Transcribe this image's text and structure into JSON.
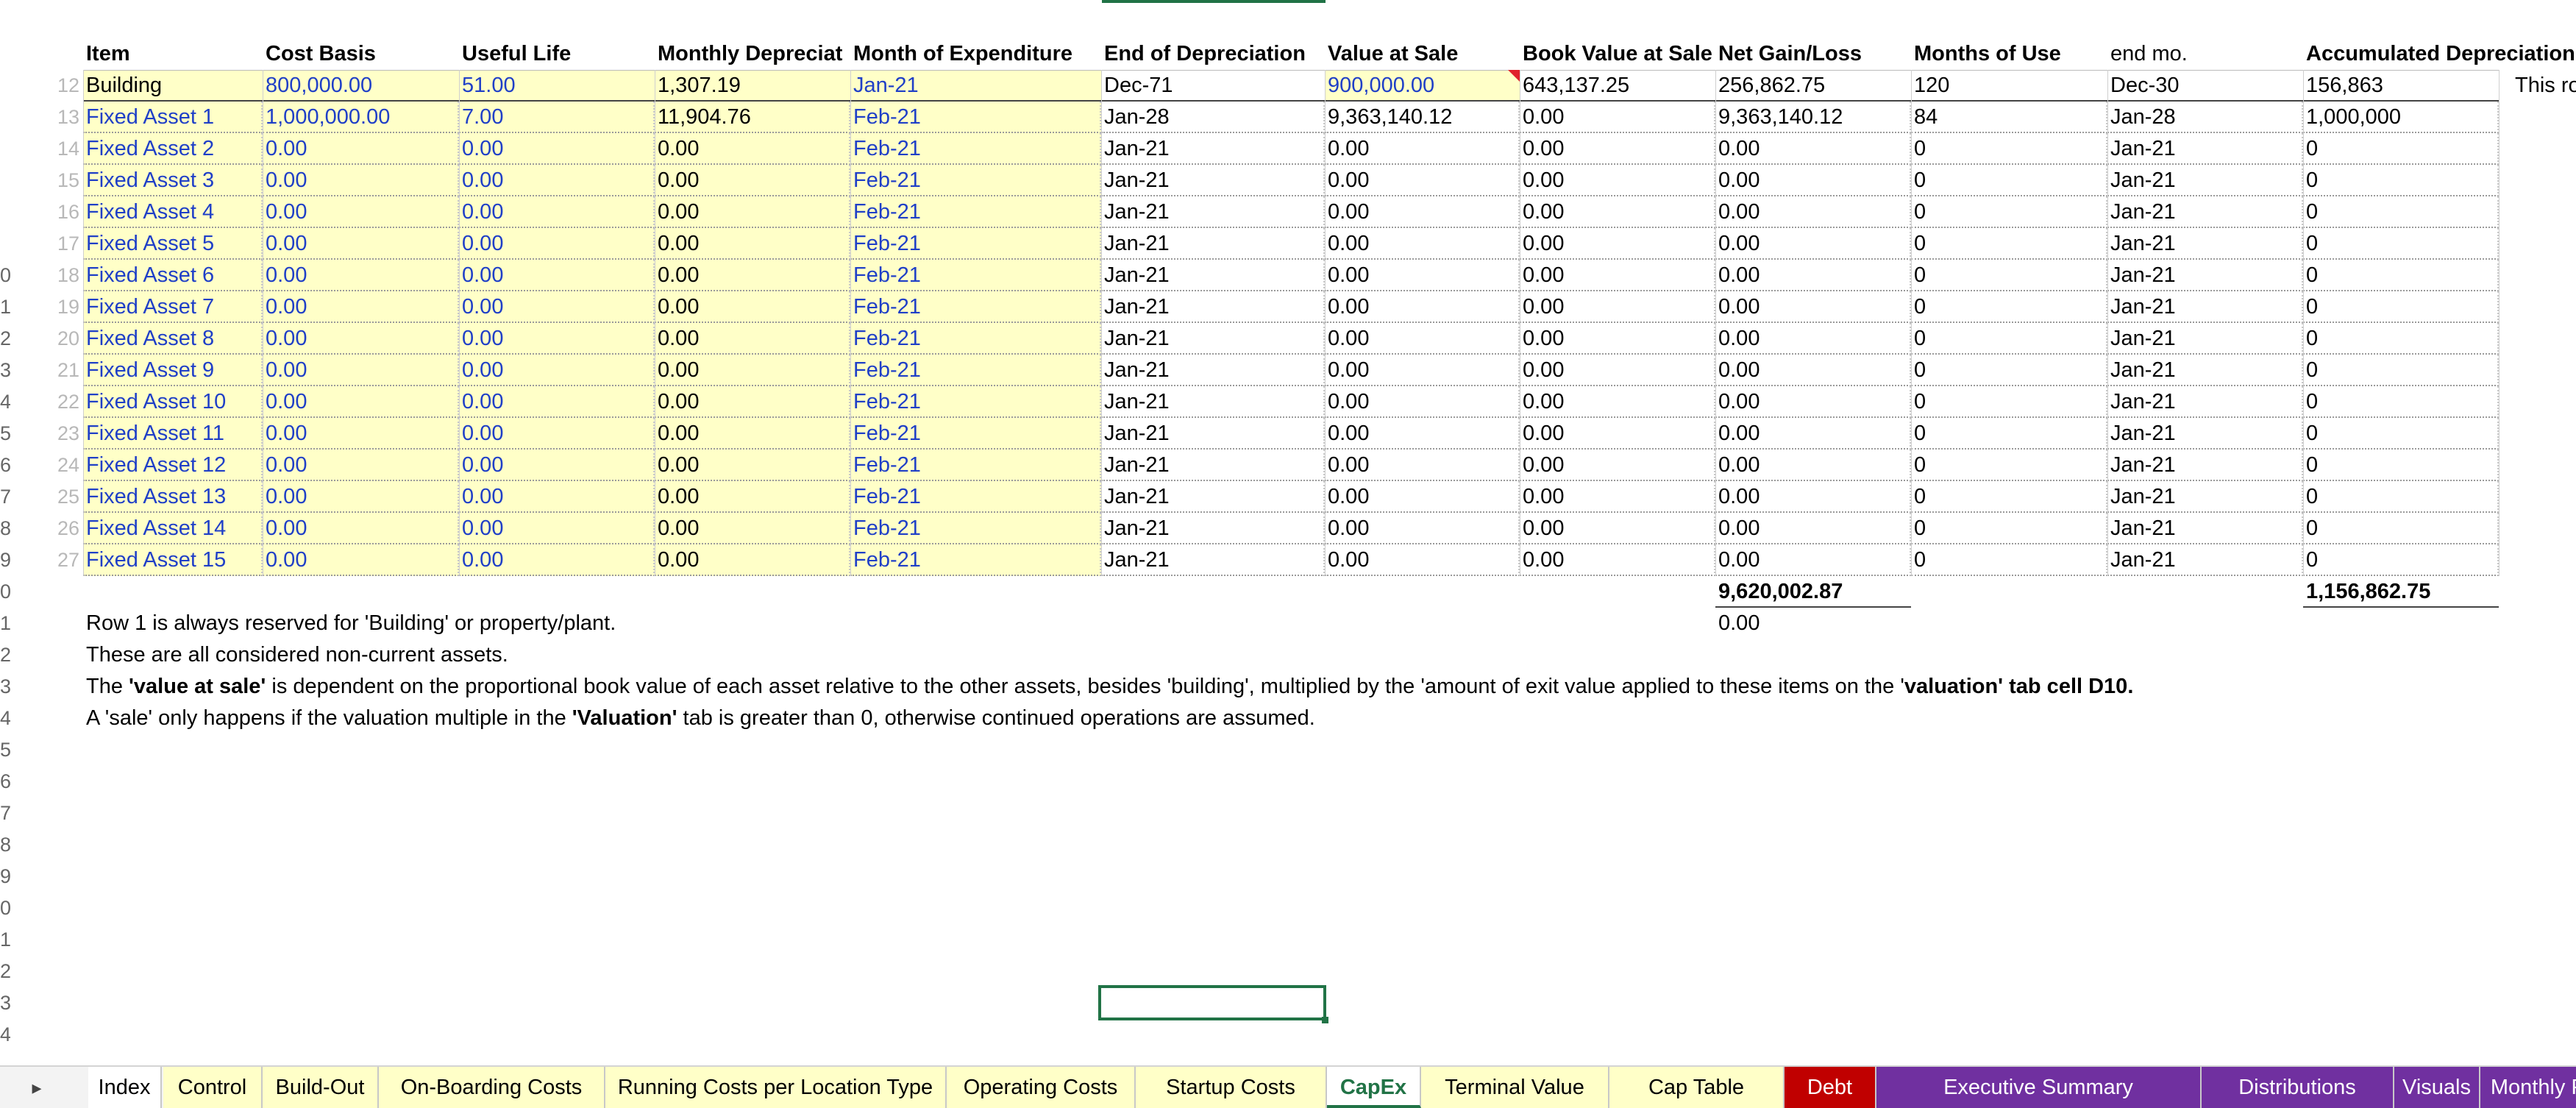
{
  "sheet": {
    "headers": [
      "Item",
      "Cost Basis",
      "Useful Life",
      "Monthly Depreciat",
      "Month of Expenditure",
      "End of Depreciation",
      "Value at Sale",
      "Book Value at Sale",
      "Net Gain/Loss",
      "Months of Use",
      "end mo.",
      "Accumulated Depreciation"
    ],
    "header_bold": [
      true,
      true,
      true,
      true,
      true,
      true,
      true,
      true,
      true,
      true,
      false,
      true
    ],
    "row_numbers": [
      "12",
      "13",
      "14",
      "15",
      "16",
      "17",
      "18",
      "19",
      "20",
      "21",
      "22",
      "23",
      "24",
      "25",
      "26",
      "27"
    ],
    "left_edge_numbers": [
      "",
      "",
      "",
      "",
      "",
      "",
      "",
      "0",
      "1",
      "2",
      "3",
      "4",
      "5",
      "6",
      "7",
      "8",
      "9",
      "0",
      "1",
      "2",
      "3",
      "4",
      "5",
      "6",
      "7",
      "8",
      "9",
      "0",
      "1",
      "2",
      "3",
      "4"
    ],
    "rows": [
      [
        "Building",
        "800,000.00",
        "51.00",
        "1,307.19",
        "Jan-21",
        "Dec-71",
        "900,000.00",
        "643,137.25",
        "256,862.75",
        "120",
        "Dec-30",
        "156,863"
      ],
      [
        "Fixed Asset 1",
        "1,000,000.00",
        "7.00",
        "11,904.76",
        "Feb-21",
        "Jan-28",
        "9,363,140.12",
        "0.00",
        "9,363,140.12",
        "84",
        "Jan-28",
        "1,000,000"
      ],
      [
        "Fixed Asset 2",
        "0.00",
        "0.00",
        "0.00",
        "Feb-21",
        "Jan-21",
        "0.00",
        "0.00",
        "0.00",
        "0",
        "Jan-21",
        "0"
      ],
      [
        "Fixed Asset 3",
        "0.00",
        "0.00",
        "0.00",
        "Feb-21",
        "Jan-21",
        "0.00",
        "0.00",
        "0.00",
        "0",
        "Jan-21",
        "0"
      ],
      [
        "Fixed Asset 4",
        "0.00",
        "0.00",
        "0.00",
        "Feb-21",
        "Jan-21",
        "0.00",
        "0.00",
        "0.00",
        "0",
        "Jan-21",
        "0"
      ],
      [
        "Fixed Asset 5",
        "0.00",
        "0.00",
        "0.00",
        "Feb-21",
        "Jan-21",
        "0.00",
        "0.00",
        "0.00",
        "0",
        "Jan-21",
        "0"
      ],
      [
        "Fixed Asset 6",
        "0.00",
        "0.00",
        "0.00",
        "Feb-21",
        "Jan-21",
        "0.00",
        "0.00",
        "0.00",
        "0",
        "Jan-21",
        "0"
      ],
      [
        "Fixed Asset 7",
        "0.00",
        "0.00",
        "0.00",
        "Feb-21",
        "Jan-21",
        "0.00",
        "0.00",
        "0.00",
        "0",
        "Jan-21",
        "0"
      ],
      [
        "Fixed Asset 8",
        "0.00",
        "0.00",
        "0.00",
        "Feb-21",
        "Jan-21",
        "0.00",
        "0.00",
        "0.00",
        "0",
        "Jan-21",
        "0"
      ],
      [
        "Fixed Asset 9",
        "0.00",
        "0.00",
        "0.00",
        "Feb-21",
        "Jan-21",
        "0.00",
        "0.00",
        "0.00",
        "0",
        "Jan-21",
        "0"
      ],
      [
        "Fixed Asset 10",
        "0.00",
        "0.00",
        "0.00",
        "Feb-21",
        "Jan-21",
        "0.00",
        "0.00",
        "0.00",
        "0",
        "Jan-21",
        "0"
      ],
      [
        "Fixed Asset 11",
        "0.00",
        "0.00",
        "0.00",
        "Feb-21",
        "Jan-21",
        "0.00",
        "0.00",
        "0.00",
        "0",
        "Jan-21",
        "0"
      ],
      [
        "Fixed Asset 12",
        "0.00",
        "0.00",
        "0.00",
        "Feb-21",
        "Jan-21",
        "0.00",
        "0.00",
        "0.00",
        "0",
        "Jan-21",
        "0"
      ],
      [
        "Fixed Asset 13",
        "0.00",
        "0.00",
        "0.00",
        "Feb-21",
        "Jan-21",
        "0.00",
        "0.00",
        "0.00",
        "0",
        "Jan-21",
        "0"
      ],
      [
        "Fixed Asset 14",
        "0.00",
        "0.00",
        "0.00",
        "Feb-21",
        "Jan-21",
        "0.00",
        "0.00",
        "0.00",
        "0",
        "Jan-21",
        "0"
      ],
      [
        "Fixed Asset 15",
        "0.00",
        "0.00",
        "0.00",
        "Feb-21",
        "Jan-21",
        "0.00",
        "0.00",
        "0.00",
        "0",
        "Jan-21",
        "0"
      ]
    ],
    "overflow_text": "This row",
    "totals": {
      "net_gain_loss": "9,620,002.87",
      "accumulated_depreciation": "1,156,862.75",
      "below_net_gain": "0.00"
    },
    "notes": [
      [
        {
          "t": "Row 1 is always reserved for 'Building' or property/plant.",
          "b": false
        }
      ],
      [
        {
          "t": "These are all considered non-current assets.",
          "b": false
        }
      ],
      [
        {
          "t": "The ",
          "b": false
        },
        {
          "t": "'value at sale'",
          "b": true
        },
        {
          "t": " is dependent on the proportional book value of each asset relative to the other assets, besides 'building', multiplied by the 'amount of exit value applied to these items on the '",
          "b": false
        },
        {
          "t": "valuation' tab cell D10.",
          "b": true
        }
      ],
      [
        {
          "t": "A 'sale' only happens if the valuation multiple in the ",
          "b": false
        },
        {
          "t": "'Valuation'",
          "b": true
        },
        {
          "t": " tab is greater than 0, otherwise continued operations are assumed.",
          "b": false
        }
      ]
    ]
  },
  "colors": {
    "input_blue": "#1f3fc7",
    "input_fill": "#ffffc8",
    "excel_green": "#217346",
    "tab_red": "#c00000",
    "tab_purple": "#7030a0"
  },
  "tabs": {
    "nav_prev": "◂",
    "nav_next": "▸",
    "items": [
      {
        "label": "Index",
        "style": "plain"
      },
      {
        "label": "Control",
        "style": "yellowtab"
      },
      {
        "label": "Build-Out",
        "style": "yellowtab"
      },
      {
        "label": "On-Boarding Costs",
        "style": "yellowtab"
      },
      {
        "label": "Running Costs per Location Type",
        "style": "yellowtab"
      },
      {
        "label": "Operating Costs",
        "style": "yellowtab"
      },
      {
        "label": "Startup Costs",
        "style": "yellowtab"
      },
      {
        "label": "CapEx",
        "style": "active"
      },
      {
        "label": "Terminal Value",
        "style": "yellowtab"
      },
      {
        "label": "Cap Table",
        "style": "yellowtab"
      },
      {
        "label": "Debt",
        "style": "redtab"
      },
      {
        "label": "Executive Summary",
        "style": "purpletab"
      },
      {
        "label": "Distributions",
        "style": "purpletab"
      },
      {
        "label": "Visuals",
        "style": "purpletab"
      },
      {
        "label": "Monthly P&",
        "style": "purpletab"
      }
    ],
    "more": "...",
    "add_sheet": "⊕",
    "options": "⋮"
  }
}
